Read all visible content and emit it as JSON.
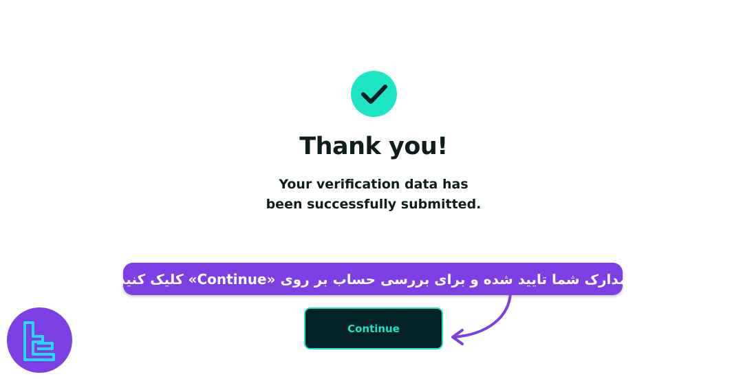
{
  "success": {
    "icon": "checkmark-icon",
    "title": "Thank you!",
    "message_line1": "Your verification data has",
    "message_line2": "been successfully submitted."
  },
  "callout": {
    "text": "مدارک شما تایید شده و برای بررسی حساب بر روی «Continue»  کلیک کنید"
  },
  "actions": {
    "continue_label": "Continue"
  },
  "brand": {
    "logo_icon": "tc-logo-icon"
  },
  "colors": {
    "accent": "#1de4c3",
    "button_bg": "#022228",
    "callout_bg": "#7b3fe4",
    "text": "#0f1d1d"
  }
}
